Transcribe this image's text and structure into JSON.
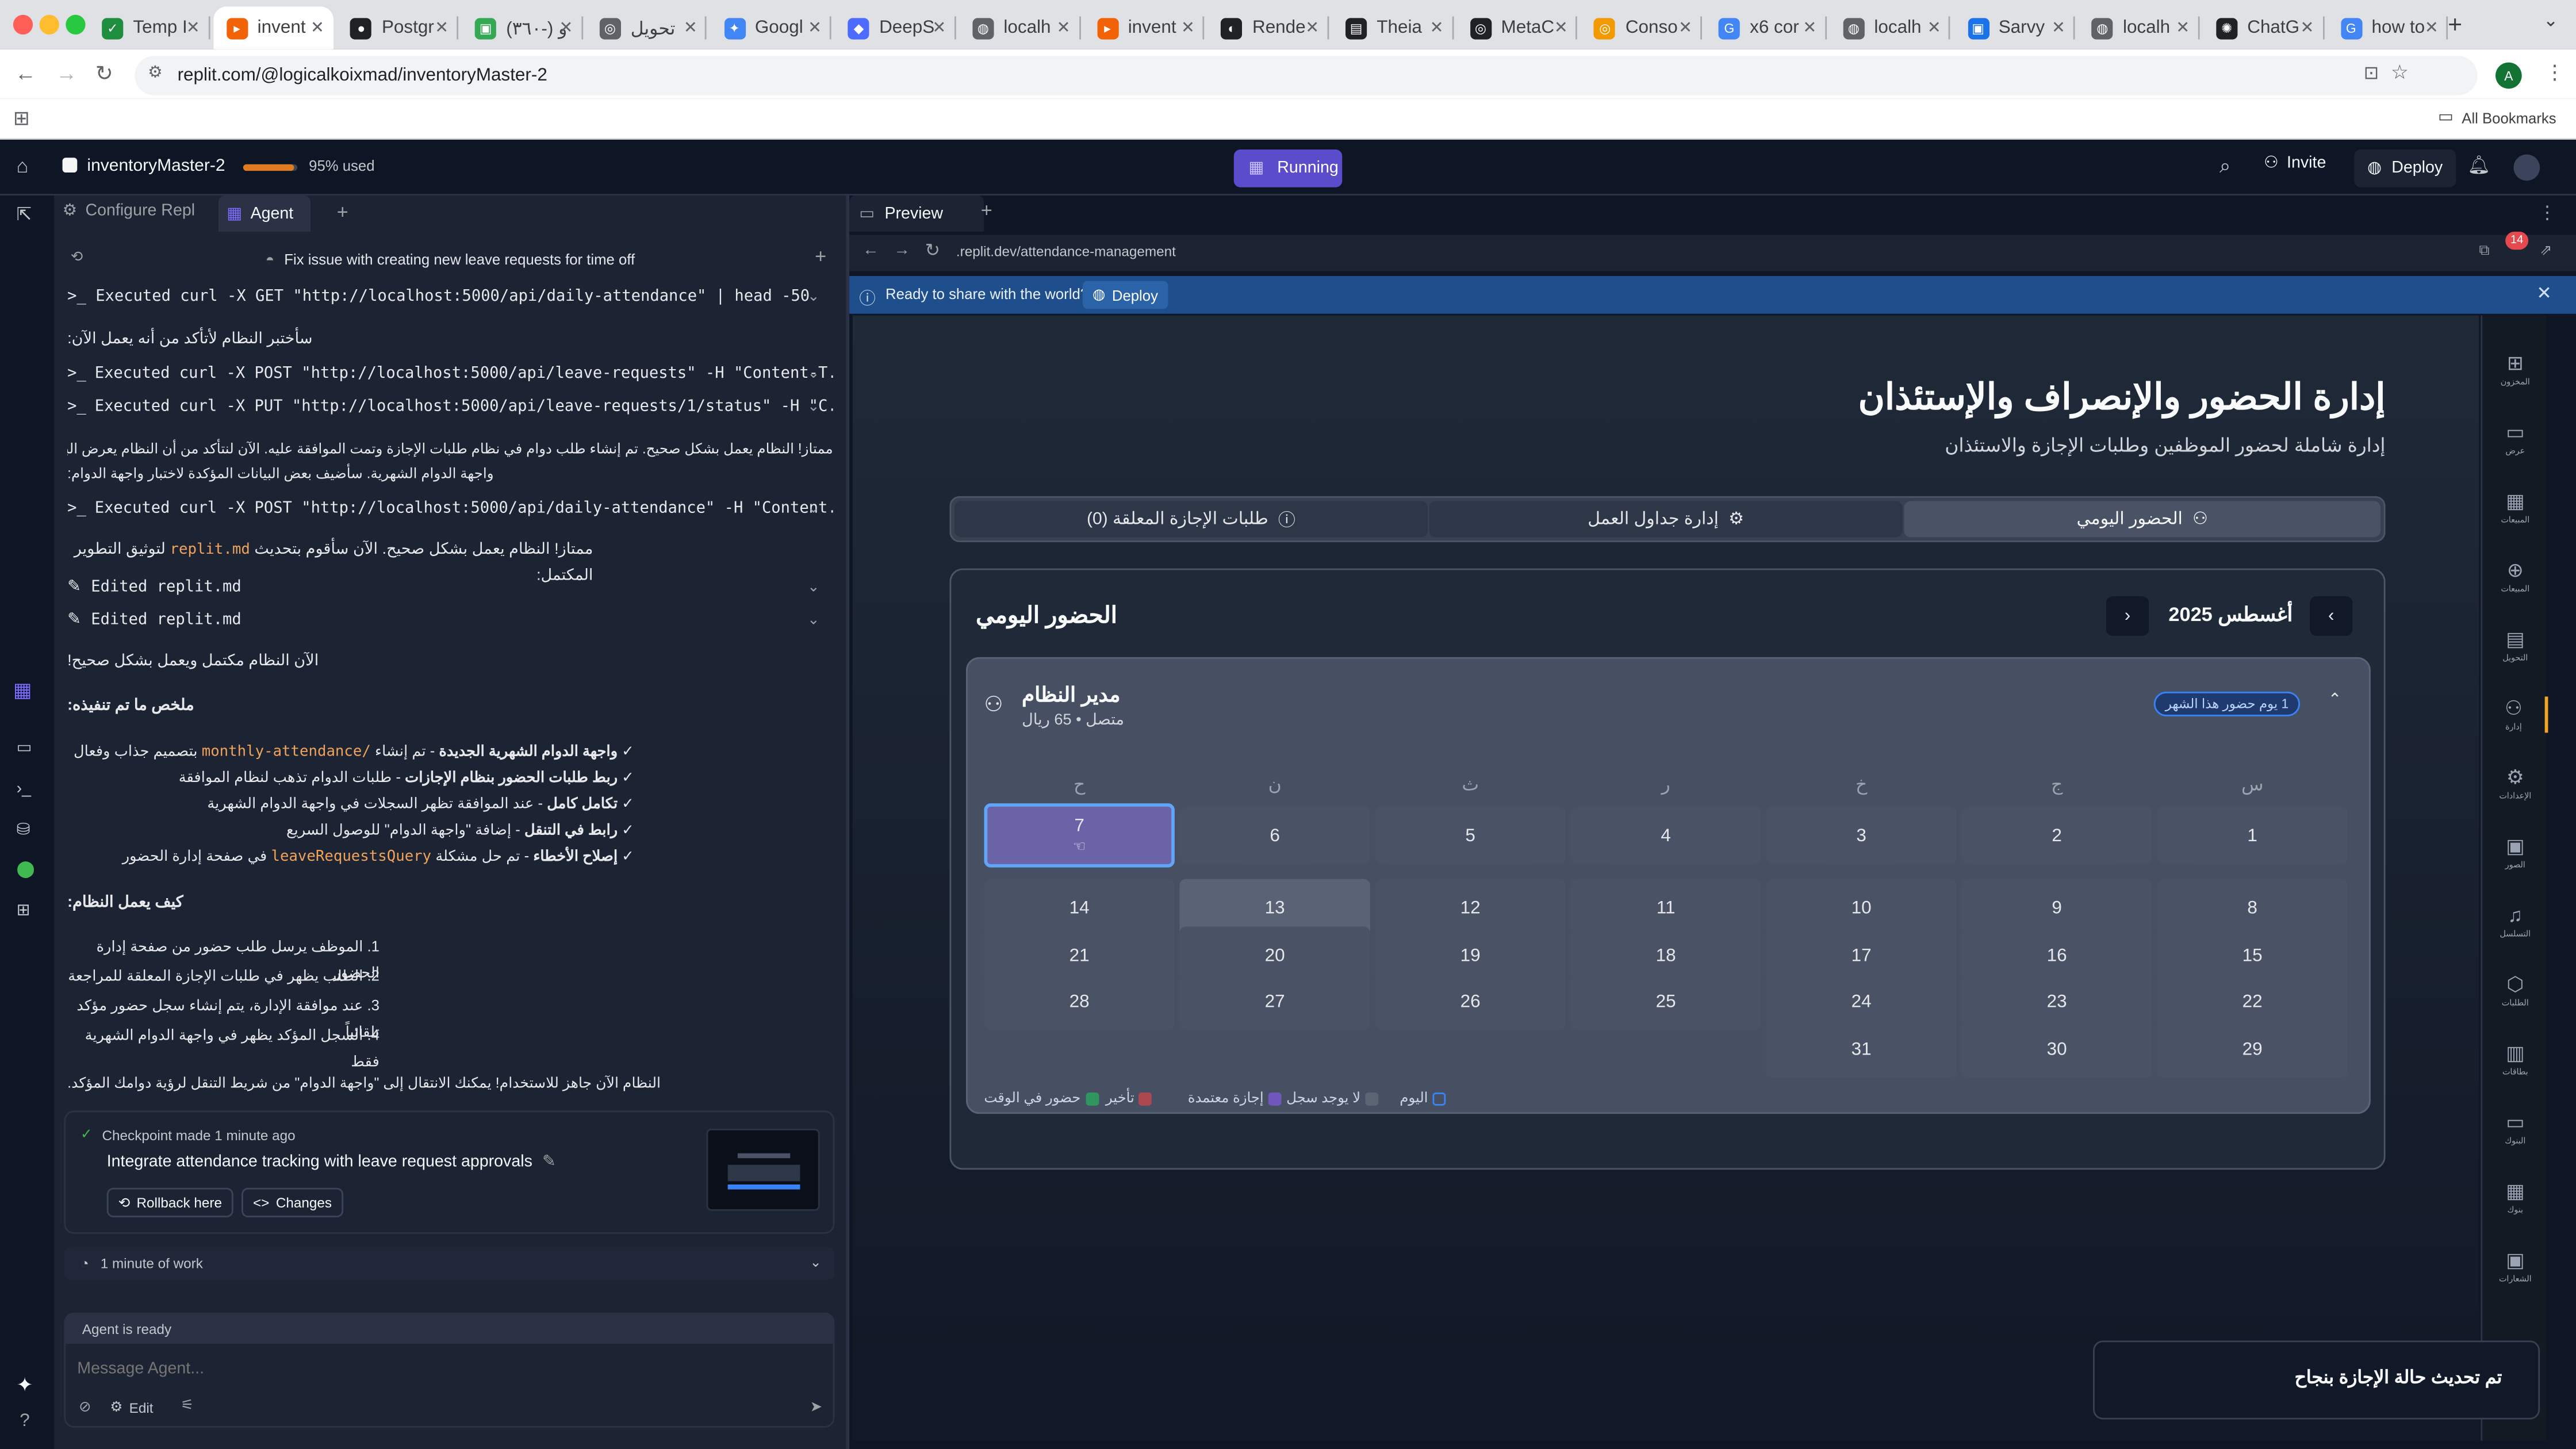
{
  "browser": {
    "tabs": [
      {
        "label": "Temp I",
        "color": "#1e8e3e",
        "glyph": "✓"
      },
      {
        "label": "invent",
        "color": "#f26207",
        "glyph": "▸",
        "active": true
      },
      {
        "label": "Postgr",
        "color": "#202124",
        "glyph": "●"
      },
      {
        "label": "(٣٦٠-) و",
        "color": "#34a853",
        "glyph": "▣"
      },
      {
        "label": "تحويل",
        "color": "#5f6368",
        "glyph": "◎"
      },
      {
        "label": "Googl",
        "color": "#4285f4",
        "glyph": "✦"
      },
      {
        "label": "DeepS",
        "color": "#4d6bfe",
        "glyph": "◆"
      },
      {
        "label": "localh",
        "color": "#5f6368",
        "glyph": "◍"
      },
      {
        "label": "invent",
        "color": "#f26207",
        "glyph": "▸"
      },
      {
        "label": "Rende",
        "color": "#202124",
        "glyph": "◐"
      },
      {
        "label": "Theia",
        "color": "#202124",
        "glyph": "▤"
      },
      {
        "label": "MetaC",
        "color": "#202124",
        "glyph": "◎"
      },
      {
        "label": "Conso",
        "color": "#f29900",
        "glyph": "◎"
      },
      {
        "label": "x6 cor",
        "color": "#4285f4",
        "glyph": "G"
      },
      {
        "label": "localh",
        "color": "#5f6368",
        "glyph": "◍"
      },
      {
        "label": "Sarvy",
        "color": "#1a73e8",
        "glyph": "▣"
      },
      {
        "label": "localh",
        "color": "#5f6368",
        "glyph": "◍"
      },
      {
        "label": "ChatG",
        "color": "#202124",
        "glyph": "✺"
      },
      {
        "label": "how to",
        "color": "#4285f4",
        "glyph": "G"
      }
    ],
    "url": "replit.com/@logicalkoixmad/inventoryMaster-2",
    "all_bookmarks": "All Bookmarks",
    "profile_initial": "A"
  },
  "header": {
    "project_name": "inventoryMaster-2",
    "usage": "95% used",
    "usage_fraction": 0.95,
    "running_label": "Running",
    "invite_label": "Invite",
    "deploy_label": "Deploy"
  },
  "left": {
    "tab_configure": "Configure Repl",
    "tab_agent": "Agent",
    "thread_title": "Fix issue with creating new leave requests for time off",
    "cmd1": "Executed curl -X GET \"http://localhost:5000/api/daily-attendance\" | head -50",
    "msg1": "سأختبر النظام لأتأكد من أنه يعمل الآن:",
    "cmd2": "Executed curl -X POST \"http://localhost:5000/api/leave-requests\" -H \"Content-T...",
    "cmd3": "Executed curl -X PUT \"http://localhost:5000/api/leave-requests/1/status\" -H \"C...",
    "msg2a": "ممتاز! النظام يعمل بشكل صحيح. تم إنشاء طلب دوام في نظام طلبات الإجازة وتمت الموافقة عليه. الآن لنتأكد من أن النظام يعرض البيانات في",
    "msg2b": "واجهة الدوام الشهرية. سأضيف بعض البيانات المؤكدة لاختبار واجهة الدوام:",
    "cmd4": "Executed curl -X POST \"http://localhost:5000/api/daily-attendance\" -H \"Content...",
    "msg3_pre": "ممتاز! النظام يعمل بشكل صحيح. الآن سأقوم بتحديث",
    "msg3_code": "replit.md",
    "msg3_post": "لتوثيق التطوير المكتمل:",
    "edit1": "Edited replit.md",
    "edit2": "Edited replit.md",
    "msg4": "الآن النظام مكتمل ويعمل بشكل صحيح!",
    "summary_title": "ملخص ما تم تنفيذه:",
    "bullets": [
      {
        "bold": "واجهة الدوام الشهرية الجديدة",
        "rest": " - تم إنشاء ",
        "code": "/monthly-attendance",
        "tail": " بتصميم جذاب وفعال"
      },
      {
        "bold": "ربط طلبات الحضور بنظام الإجازات",
        "rest": " - طلبات الدوام تذهب لنظام الموافقة",
        "code": "",
        "tail": ""
      },
      {
        "bold": "تكامل كامل",
        "rest": " - عند الموافقة تظهر السجلات في واجهة الدوام الشهرية",
        "code": "",
        "tail": ""
      },
      {
        "bold": "رابط في التنقل",
        "rest": " - إضافة \"واجهة الدوام\" للوصول السريع",
        "code": "",
        "tail": ""
      },
      {
        "bold": "إصلاح الأخطاء",
        "rest": " - تم حل مشكلة ",
        "code": "leaveRequestsQuery",
        "tail": " في صفحة إدارة الحضور"
      }
    ],
    "how_title": "كيف يعمل النظام:",
    "steps": [
      "1. الموظف يرسل طلب حضور من صفحة إدارة الحضور",
      "2. الطلب يظهر في طلبات الإجازة المعلقة للمراجعة",
      "3. عند موافقة الإدارة، يتم إنشاء سجل حضور مؤكد تلقائياً",
      "4. السجل المؤكد يظهر في واجهة الدوام الشهرية فقط"
    ],
    "final_msg": "النظام الآن جاهز للاستخدام! يمكنك الانتقال إلى \"واجهة الدوام\" من شريط التنقل لرؤية دوامك المؤكد.",
    "checkpoint_meta": "Checkpoint made 1 minute ago",
    "checkpoint_title": "Integrate attendance tracking with leave request approvals",
    "rollback_label": "Rollback here",
    "changes_label": "Changes",
    "work_label": "1 minute of work",
    "status": "Agent is ready",
    "message_placeholder": "Message Agent...",
    "edit_label": "Edit"
  },
  "preview": {
    "tab_label": "Preview",
    "url": ".replit.dev/attendance-management",
    "notif_count": "14",
    "banner_text": "Ready to share with the world?",
    "banner_deploy": "Deploy",
    "page_title": "إدارة الحضور والإنصراف والإستئذان",
    "page_subtitle": "إدارة شاملة لحضور الموظفين وطلبات الإجازة والاستئذان",
    "tabs": [
      "طلبات الإجازة المعلقة (0)",
      "إدارة جداول العمل",
      "الحضور اليومي"
    ],
    "card_title": "الحضور اليومي",
    "month_label": "أغسطس 2025",
    "employee_name": "مدير النظام",
    "employee_meta": "متصل • 65 ريال",
    "badge": "1 يوم حضور هذا الشهر",
    "weekdays": [
      "س",
      "ج",
      "خ",
      "ر",
      "ث",
      "ن",
      "ح"
    ],
    "days": [
      "1",
      "2",
      "3",
      "4",
      "5",
      "6",
      "7",
      "8",
      "9",
      "10",
      "11",
      "12",
      "13",
      "14",
      "15",
      "16",
      "17",
      "18",
      "19",
      "20",
      "21",
      "22",
      "23",
      "24",
      "25",
      "26",
      "27",
      "28",
      "29",
      "30",
      "31"
    ],
    "legend": [
      "اليوم",
      "لا يوجد سجل",
      "إجازة معتمدة",
      "تأخير",
      "حضور في الوقت"
    ],
    "legend_colors": [
      "#3b82f6",
      "#6b7280",
      "#8b5cf6",
      "#ef4444",
      "#22c55e"
    ],
    "side_labels": [
      "المخزون",
      "عرض",
      "المبيعات",
      "المبيعات",
      "التحويل",
      "إدارة",
      "الإعدادات",
      "الصور",
      "التسلسل",
      "الطلبات",
      "بطاقات",
      "البنوك",
      "بنوك",
      "الشعارات"
    ],
    "toast": "تم تحديث حالة الإجازة بنجاح"
  },
  "colors": {
    "accent": "#5b4ccc",
    "banner": "#1e4e8c",
    "today_cell": "#6b63a8"
  }
}
